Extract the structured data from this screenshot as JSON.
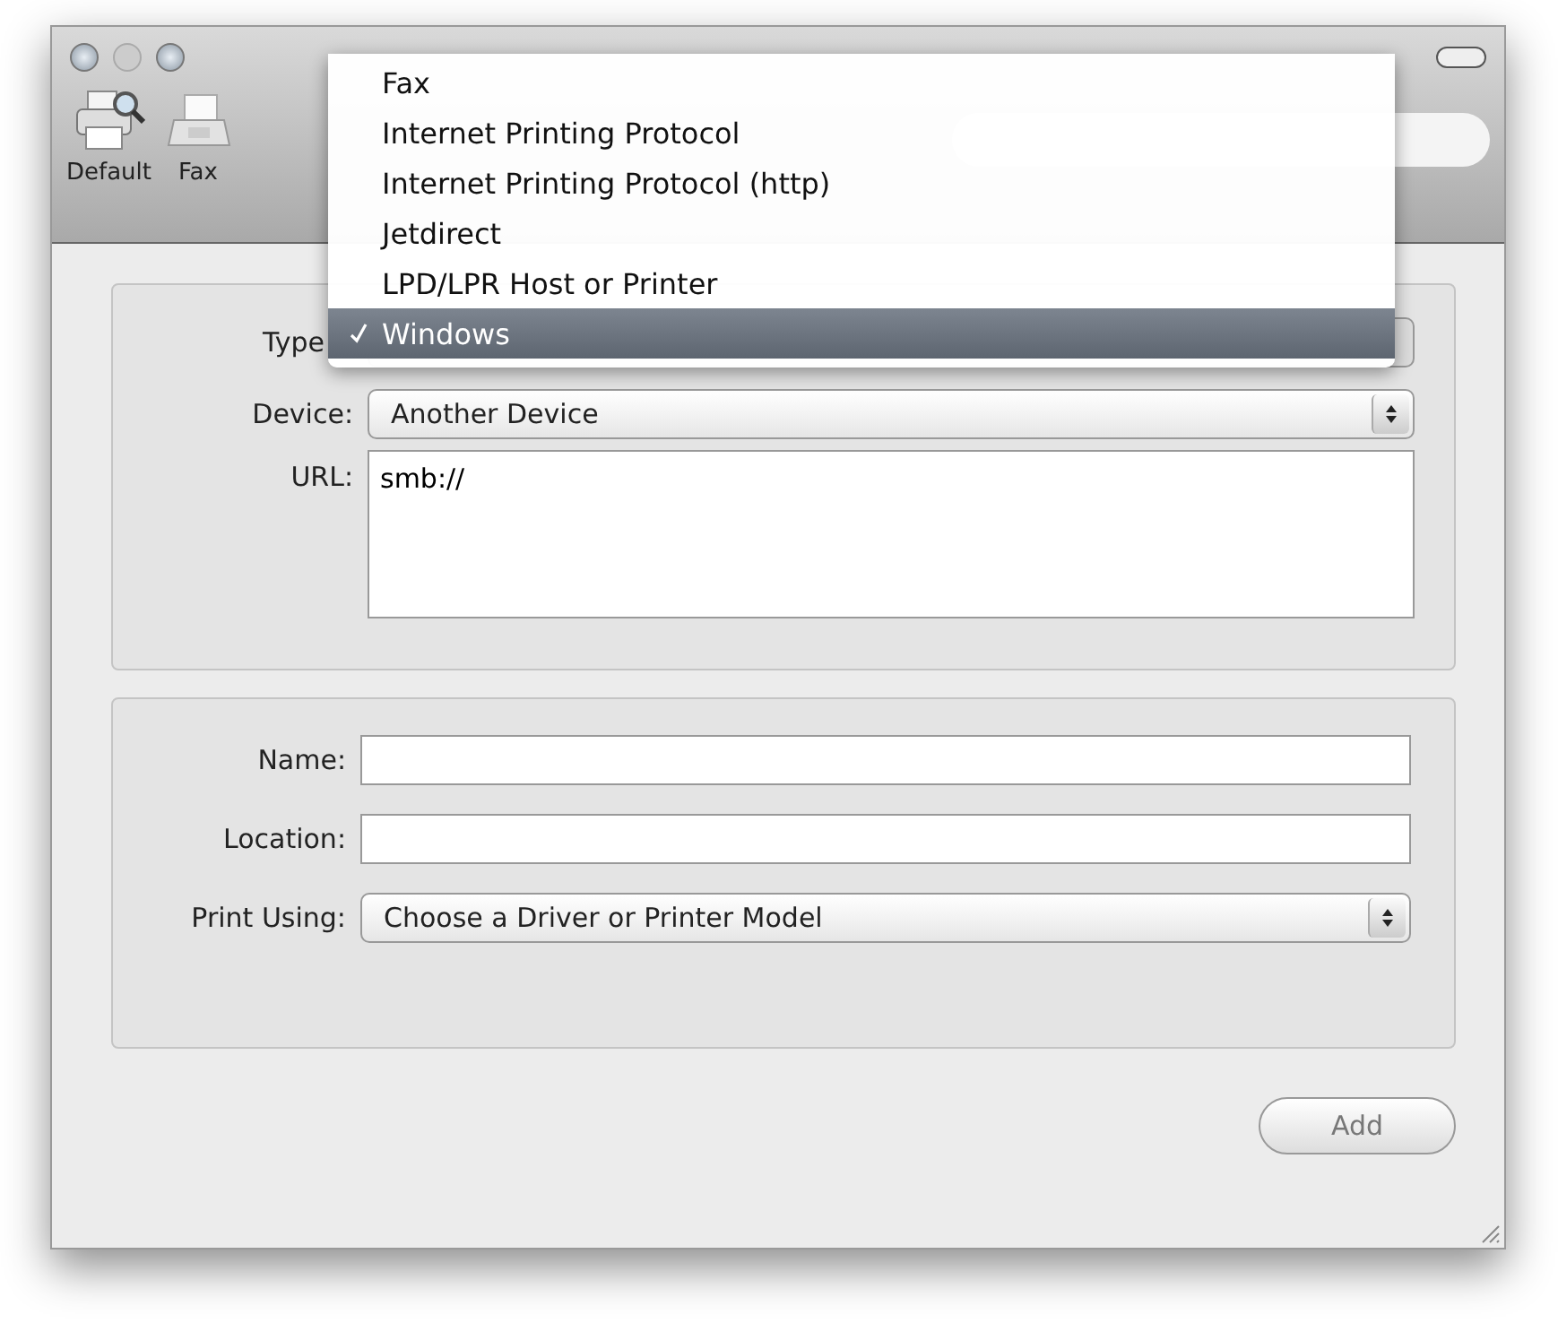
{
  "toolbar": {
    "items": [
      {
        "label": "Default",
        "kind": "printer"
      },
      {
        "label": "Fax",
        "kind": "fax"
      }
    ]
  },
  "connection": {
    "type_label": "Type",
    "type_menu": [
      {
        "label": "Fax",
        "selected": false
      },
      {
        "label": "Internet Printing Protocol",
        "selected": false
      },
      {
        "label": "Internet Printing Protocol (http)",
        "selected": false
      },
      {
        "label": "Jetdirect",
        "selected": false
      },
      {
        "label": "LPD/LPR Host or Printer",
        "selected": false
      },
      {
        "label": "Windows",
        "selected": true
      }
    ],
    "device_label": "Device:",
    "device_value": "Another Device",
    "url_label": "URL:",
    "url_value": "smb://"
  },
  "details": {
    "name_label": "Name:",
    "location_label": "Location:",
    "print_using_label": "Print Using:",
    "print_using_value": "Choose a Driver or Printer Model"
  },
  "buttons": [
    {
      "label": "Add",
      "disabled": true
    }
  ]
}
